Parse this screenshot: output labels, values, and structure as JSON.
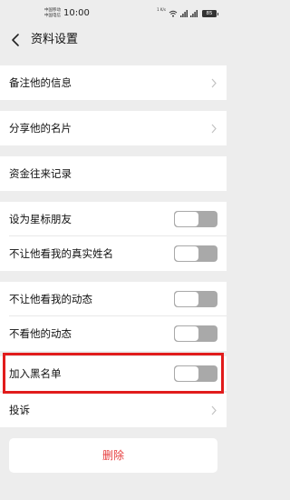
{
  "status_bar": {
    "carrier_1": "中国移动",
    "carrier_2": "中国电信",
    "time": "10:00",
    "net_speed": "1 K/s",
    "battery": "85"
  },
  "header": {
    "title": "资料设置"
  },
  "rows": {
    "remark": "备注他的信息",
    "share_card": "分享他的名片",
    "fund_records": "资金往来记录",
    "star_friend": "设为星标朋友",
    "hide_real_name": "不让他看我的真实姓名",
    "hide_my_moments": "不让他看我的动态",
    "hide_his_moments": "不看他的动态",
    "blacklist": "加入黑名单",
    "complain": "投诉"
  },
  "toggles": {
    "star_friend": false,
    "hide_real_name": false,
    "hide_my_moments": false,
    "hide_his_moments": false,
    "blacklist": false
  },
  "delete_button": {
    "label": "删除"
  },
  "colors": {
    "background": "#ededed",
    "delete_text": "#e63c3c",
    "highlight_border": "#e11c1c",
    "toggle_off": "#a9a9a9"
  },
  "icons": [
    "back-arrow-icon",
    "chevron-right-icon",
    "wifi-icon",
    "signal-icon",
    "battery-icon"
  ]
}
